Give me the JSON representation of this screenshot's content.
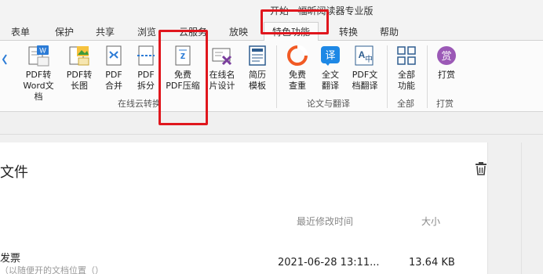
{
  "app": {
    "title": "开始 · 福昕阅读器专业版"
  },
  "tabs": [
    {
      "label": "表单"
    },
    {
      "label": "保护"
    },
    {
      "label": "共享"
    },
    {
      "label": "浏览"
    },
    {
      "label": "云服务"
    },
    {
      "label": "放映"
    },
    {
      "label": "特色功能"
    },
    {
      "label": "转换"
    },
    {
      "label": "帮助"
    }
  ],
  "ribbon": {
    "buttons": [
      {
        "line1": "PDF转",
        "line2": "Word文档",
        "icon": "pdf-to-word-icon"
      },
      {
        "line1": "PDF转",
        "line2": "长图",
        "icon": "pdf-to-image-icon"
      },
      {
        "line1": "PDF",
        "line2": "合并",
        "icon": "pdf-merge-icon"
      },
      {
        "line1": "PDF",
        "line2": "拆分",
        "icon": "pdf-split-icon"
      },
      {
        "line1": "免费",
        "line2": "PDF压缩",
        "icon": "pdf-compress-icon"
      },
      {
        "line1": "在线名",
        "line2": "片设计",
        "icon": "card-design-icon"
      },
      {
        "line1": "简历",
        "line2": "模板",
        "icon": "resume-template-icon"
      },
      {
        "line1": "免费",
        "line2": "查重",
        "icon": "plagiarism-check-icon"
      },
      {
        "line1": "全文",
        "line2": "翻译",
        "icon": "translate-icon"
      },
      {
        "line1": "PDF文",
        "line2": "档翻译",
        "icon": "doc-translate-icon"
      },
      {
        "line1": "全部",
        "line2": "功能",
        "icon": "all-features-icon"
      },
      {
        "line1": "打赏",
        "line2": "",
        "icon": "reward-icon"
      }
    ],
    "groups": [
      {
        "label": "在线云转换"
      },
      {
        "label": "论文与翻译"
      },
      {
        "label": "全部"
      },
      {
        "label": "打赏"
      }
    ]
  },
  "main": {
    "section_title": "文件",
    "columns": [
      {
        "label": "最近修改时间"
      },
      {
        "label": "大小"
      }
    ],
    "rows": [
      {
        "name": "发票",
        "sub": "（以随便开的文档位置（）",
        "modified": "2021-06-28 13:11...",
        "size": "13.64 KB"
      }
    ]
  },
  "colors": {
    "highlight": "#e0161d",
    "accent": "#2b7bd6",
    "orange": "#f15a24"
  }
}
